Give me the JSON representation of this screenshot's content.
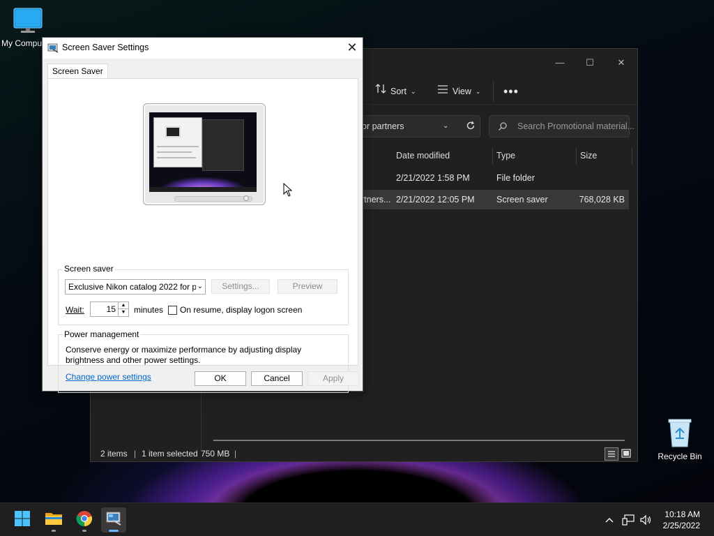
{
  "desktop": {
    "icons": [
      {
        "label": "My Computer"
      },
      {
        "label": "Recycle Bin"
      }
    ]
  },
  "explorer": {
    "toolbar": {
      "sort_label": "Sort",
      "view_label": "View"
    },
    "address_text": "or partners",
    "search_placeholder": "Search Promotional material...",
    "columns": [
      "Date modified",
      "Type",
      "Size"
    ],
    "rows": [
      {
        "name": "",
        "date": "2/21/2022 1:58 PM",
        "type": "File folder",
        "size": ""
      },
      {
        "name": "rtners...",
        "date": "2/21/2022 12:05 PM",
        "type": "Screen saver",
        "size": "768,028 KB"
      }
    ],
    "status": {
      "items": "2 items",
      "selected": "1 item selected",
      "size": "750 MB"
    }
  },
  "dialog": {
    "title": "Screen Saver Settings",
    "tab": "Screen Saver",
    "screensaver_group": "Screen saver",
    "screensaver_selected": "Exclusive Nikon catalog 2022 for p",
    "settings_button": "Settings...",
    "preview_button": "Preview",
    "wait_label": "Wait:",
    "wait_value": "15",
    "minutes_label": "minutes",
    "resume_label": "On resume, display logon screen",
    "resume_checked": false,
    "power_group": "Power management",
    "power_text": "Conserve energy or maximize performance by adjusting display brightness and other power settings.",
    "power_link": "Change power settings",
    "ok": "OK",
    "cancel": "Cancel",
    "apply": "Apply"
  },
  "taskbar": {
    "time": "10:18 AM",
    "date": "2/25/2022"
  }
}
